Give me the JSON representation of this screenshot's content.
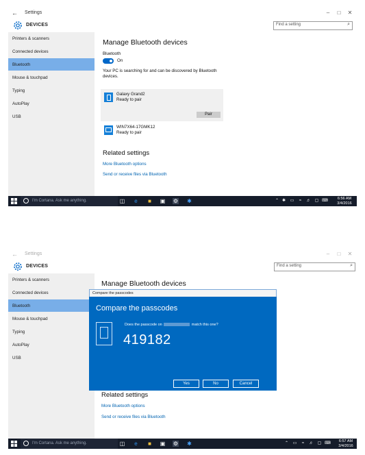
{
  "common": {
    "back_glyph": "←",
    "title": "Settings",
    "win_min": "–",
    "win_max": "□",
    "win_close": "✕",
    "header": "DEVICES",
    "search_placeholder": "Find a setting",
    "search_glyph": "⌕",
    "sidebar": [
      "Printers & scanners",
      "Connected devices",
      "Bluetooth",
      "Mouse & touchpad",
      "Typing",
      "AutoPlay",
      "USB"
    ],
    "cortana_text": "I'm Cortana. Ask me anything."
  },
  "shot1": {
    "heading": "Manage Bluetooth devices",
    "bt_label": "Bluetooth",
    "bt_state": "On",
    "status_text": "Your PC is searching for and can be discovered by Bluetooth devices.",
    "device1_name": "Galaxy Grand2",
    "device1_status": "Ready to pair",
    "pair_label": "Pair",
    "device2_name": "WIN7X64-17GMK12",
    "device2_status": "Ready to pair",
    "related_heading": "Related settings",
    "link1": "More Bluetooth options",
    "link2": "Send or receive files via Bluetooth",
    "clock_time": "6:56 AM",
    "clock_date": "3/4/2016"
  },
  "shot2": {
    "heading": "Manage Bluetooth devices",
    "dialog_caption": "Compare the passcodes",
    "dialog_title": "Compare the passcodes",
    "dialog_msg_prefix": "Does the passcode on",
    "dialog_msg_suffix": "match this one?",
    "passcode": "419182",
    "yes_label": "Yes",
    "no_label": "No",
    "cancel_label": "Cancel",
    "related_heading": "Related settings",
    "link1": "More Bluetooth options",
    "link2": "Send or receive files via Bluetooth",
    "clock_time": "6:57 AM",
    "clock_date": "3/4/2016"
  },
  "colors": {
    "accent": "#0067c8",
    "sidebar_selected": "#78aee8",
    "taskbar": "#151c2a",
    "dialog": "#0069c0"
  }
}
